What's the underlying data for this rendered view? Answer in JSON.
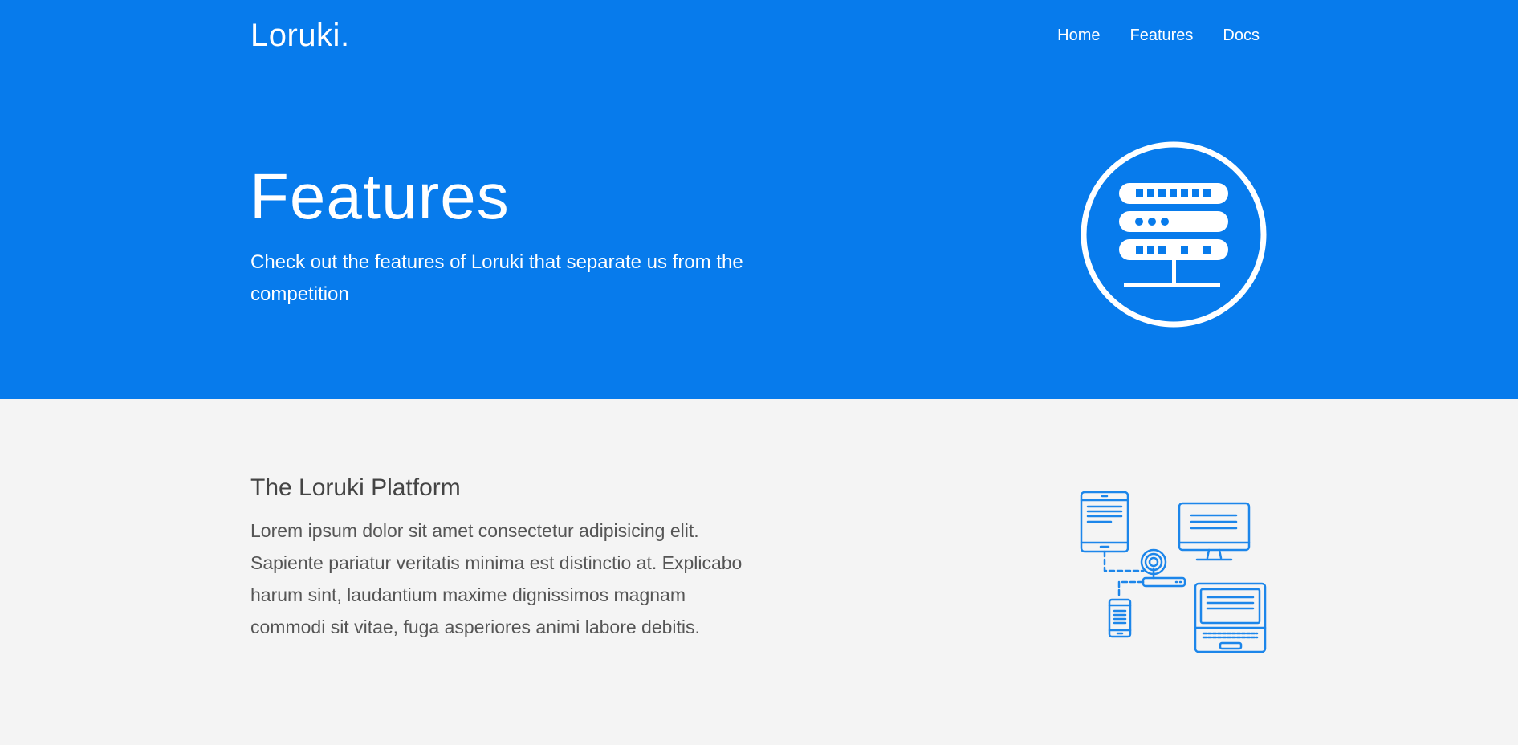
{
  "brand": "Loruki.",
  "nav": {
    "items": [
      "Home",
      "Features",
      "Docs"
    ]
  },
  "hero": {
    "title": "Features",
    "subtitle": "Check out the features of Loruki that separate us from the competition",
    "icon": "server-icon",
    "background_color": "#077bec"
  },
  "platform": {
    "title": "The Loruki Platform",
    "text": "Lorem ipsum dolor sit amet consectetur adipisicing elit. Sapiente pariatur veritatis minima est distinctio at. Explicabo harum sint, laudantium maxime dignissimos magnam commodi sit vitae, fuga asperiores animi labore debitis.",
    "icon": "network-devices-icon",
    "accent_color": "#1c86ea"
  }
}
